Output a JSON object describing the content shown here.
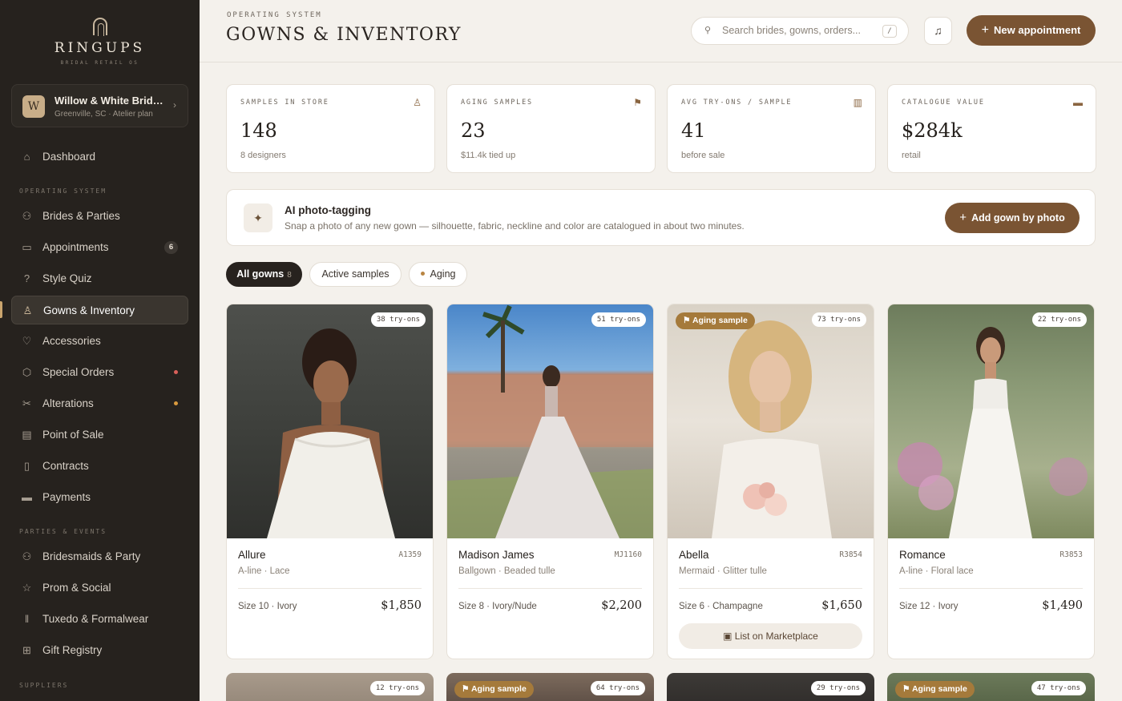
{
  "brand": {
    "name": "RINGUPS",
    "tagline": "BRIDAL RETAIL OS"
  },
  "shop": {
    "initial": "W",
    "name": "Willow & White Bridal...",
    "meta": "Greenville, SC · Atelier plan"
  },
  "nav": {
    "dashboard": "Dashboard",
    "section_os": "OPERATING SYSTEM",
    "os_items": [
      {
        "label": "Brides & Parties"
      },
      {
        "label": "Appointments",
        "badge": "6"
      },
      {
        "label": "Style Quiz"
      },
      {
        "label": "Gowns & Inventory"
      },
      {
        "label": "Accessories"
      },
      {
        "label": "Special Orders"
      },
      {
        "label": "Alterations"
      },
      {
        "label": "Point of Sale"
      },
      {
        "label": "Contracts"
      },
      {
        "label": "Payments"
      }
    ],
    "section_parties": "PARTIES & EVENTS",
    "party_items": [
      {
        "label": "Bridesmaids & Party"
      },
      {
        "label": "Prom & Social"
      },
      {
        "label": "Tuxedo & Formalwear"
      },
      {
        "label": "Gift Registry"
      }
    ],
    "section_suppliers": "SUPPLIERS",
    "dot_colors": {
      "special_orders": "#d9605a",
      "alterations": "#d99a3e"
    }
  },
  "header": {
    "eyebrow": "OPERATING SYSTEM",
    "title": "GOWNS & INVENTORY",
    "search_placeholder": "Search brides, gowns, orders...",
    "search_shortcut": "/",
    "new_appointment": "New appointment"
  },
  "stats": [
    {
      "label": "SAMPLES IN STORE",
      "value": "148",
      "sub": "8 designers",
      "icon": "hanger-icon"
    },
    {
      "label": "AGING SAMPLES",
      "value": "23",
      "sub": "$11.4k tied up",
      "icon": "flag-icon"
    },
    {
      "label": "AVG TRY-ONS / SAMPLE",
      "value": "41",
      "sub": "before sale",
      "icon": "bar-chart-icon"
    },
    {
      "label": "CATALOGUE VALUE",
      "value": "$284k",
      "sub": "retail",
      "icon": "card-icon"
    }
  ],
  "ai_banner": {
    "title": "AI photo-tagging",
    "description": "Snap a photo of any new gown — silhouette, fabric, neckline and color are catalogued in about two minutes.",
    "button": "Add gown by photo"
  },
  "filters": [
    {
      "label": "All gowns",
      "count": "8"
    },
    {
      "label": "Active samples"
    },
    {
      "label": "Aging"
    }
  ],
  "gowns": [
    {
      "name": "Allure",
      "sku": "A1359",
      "cut": "A-line · Lace",
      "size": "Size 10 · Ivory",
      "price": "$1,850",
      "tryons": "38 try-ons"
    },
    {
      "name": "Madison James",
      "sku": "MJ1160",
      "cut": "Ballgown · Beaded tulle",
      "size": "Size 8 · Ivory/Nude",
      "price": "$2,200",
      "tryons": "51 try-ons"
    },
    {
      "name": "Abella",
      "sku": "R3854",
      "cut": "Mermaid · Glitter tulle",
      "size": "Size 6 · Champagne",
      "price": "$1,650",
      "tryons": "73 try-ons",
      "badge": "Aging sample",
      "action": "List on Marketplace"
    },
    {
      "name": "Romance",
      "sku": "R3853",
      "cut": "A-line · Floral lace",
      "size": "Size 12 · Ivory",
      "price": "$1,490",
      "tryons": "22 try-ons"
    }
  ],
  "gowns_row2": [
    {
      "tryons": "12 try-ons"
    },
    {
      "tryons": "64 try-ons",
      "badge": "Aging sample"
    },
    {
      "tryons": "29 try-ons"
    },
    {
      "tryons": "47 try-ons",
      "badge": "Aging sample"
    }
  ]
}
